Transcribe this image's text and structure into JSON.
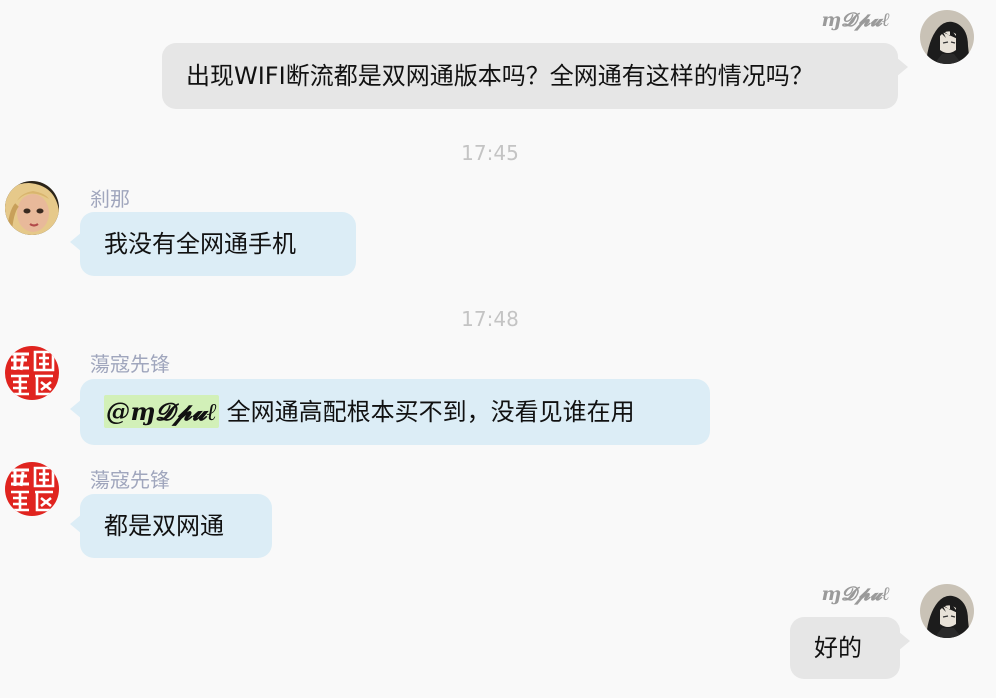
{
  "messages": [
    {
      "sender": "ɱ𝓓𝓹𝓾ℓ",
      "text": "出现WIFI断流都是双网通版本吗？全网通有这样的情况吗？"
    },
    {
      "time": "17:45"
    },
    {
      "sender": "刹那",
      "text": "我没有全网通手机"
    },
    {
      "time": "17:48"
    },
    {
      "sender": "蕩寇先锋",
      "mention": "@ɱ𝓓𝓹𝓾ℓ",
      "text": " 全网通高配根本买不到，没看见谁在用"
    },
    {
      "sender": "蕩寇先锋",
      "text": "都是双网通"
    },
    {
      "sender": "ɱ𝓓𝓹𝓾ℓ",
      "text": "好的"
    }
  ],
  "colors": {
    "incoming_bubble": "#dcedf6",
    "outgoing_bubble": "#e6e6e6",
    "mention_highlight": "#d2f0b8",
    "sender_name": "#a0a6bd",
    "timestamp": "#c4c4c4"
  },
  "avatars": {
    "self": "dark-haired-anime-character-icon",
    "chana": "blonde-doll-face-icon",
    "dangkou": "red-seal-stamp-icon"
  }
}
